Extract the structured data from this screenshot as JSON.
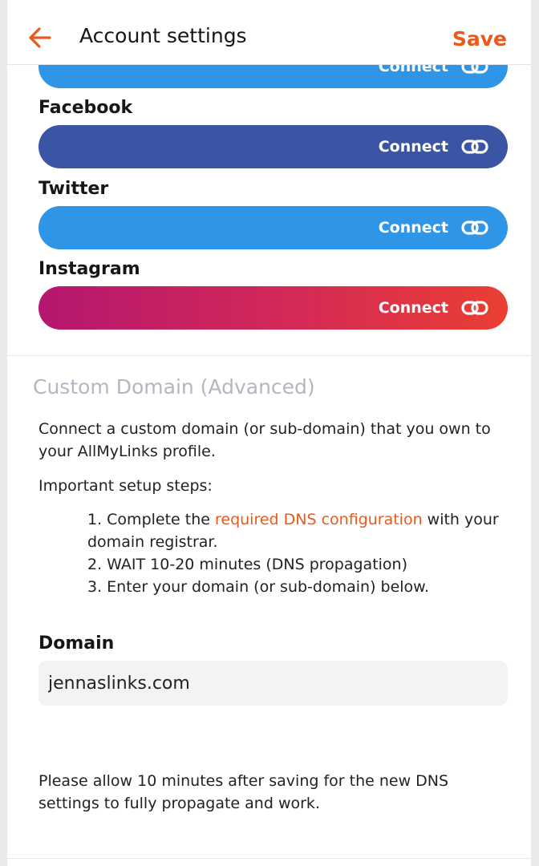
{
  "header": {
    "title": "Account settings",
    "save_label": "Save",
    "back_icon": "arrow-left-icon"
  },
  "colors": {
    "accent": "#e85a1b",
    "youtube_blue": "#2f95e6",
    "facebook": "#3a55a4",
    "twitter": "#2f95e6",
    "instagram_start": "#b5176f",
    "instagram_end": "#ea3f32"
  },
  "socials": {
    "top_partial": {
      "button_label": "Connect",
      "icon": "link-icon"
    },
    "facebook": {
      "label": "Facebook",
      "button_label": "Connect",
      "icon": "link-icon"
    },
    "twitter": {
      "label": "Twitter",
      "button_label": "Connect",
      "icon": "link-icon"
    },
    "instagram": {
      "label": "Instagram",
      "button_label": "Connect",
      "icon": "link-icon"
    }
  },
  "custom_domain": {
    "title": "Custom Domain (Advanced)",
    "description": "Connect a custom domain (or sub-domain) that you own to your AllMyLinks profile.",
    "steps_heading": "Important setup steps:",
    "step1_prefix": "1. Complete the ",
    "step1_link": "required DNS configuration",
    "step1_suffix": " with your domain registrar.",
    "step2": "2. WAIT 10-20 minutes (DNS propagation)",
    "step3": "3. Enter your domain (or sub-domain) below.",
    "domain_label": "Domain",
    "domain_value": "jennaslinks.com",
    "note": "Please allow 10 minutes after saving for the new DNS settings to fully propagate and work."
  }
}
